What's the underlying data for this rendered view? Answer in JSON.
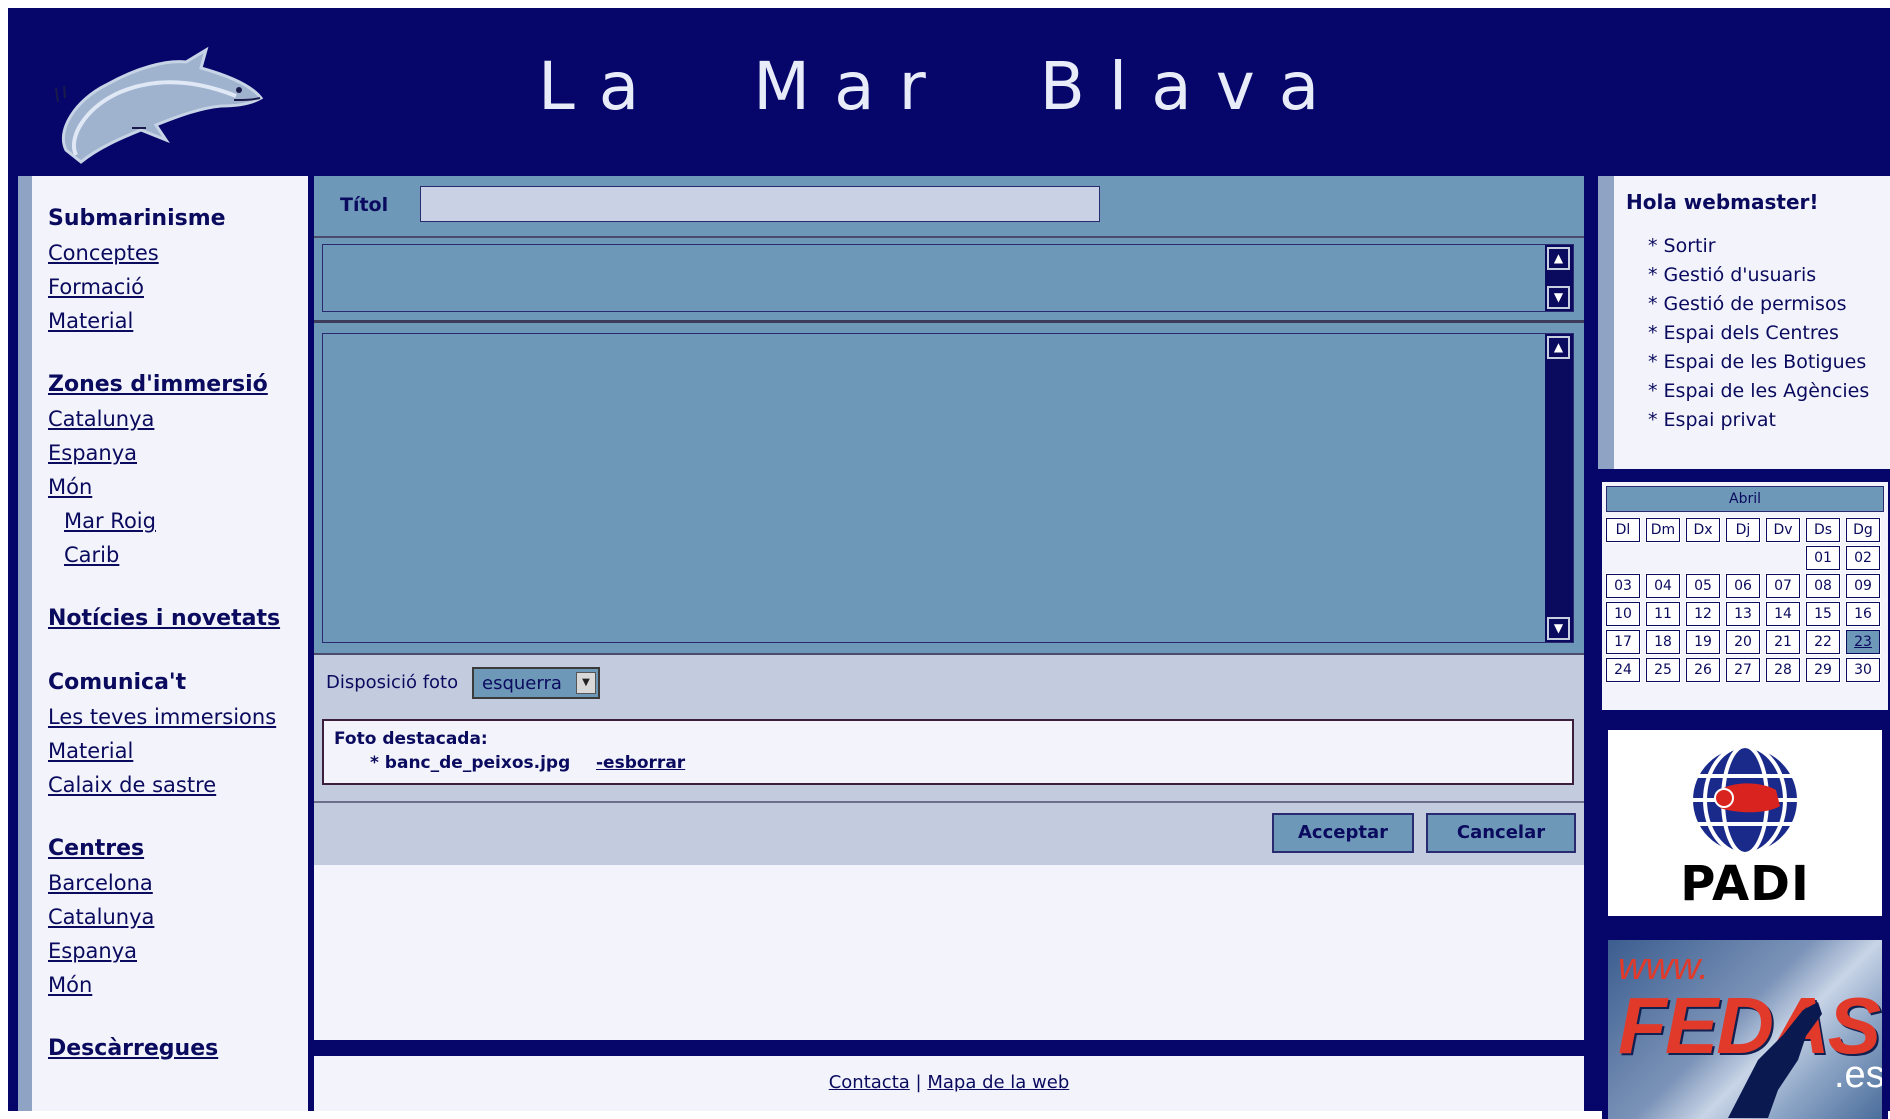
{
  "header": {
    "title": "La  Mar  Blava"
  },
  "sidebar": {
    "sections": [
      {
        "heading": "Submarinisme",
        "heading_link": false,
        "links": [
          "Conceptes",
          "Formació",
          "Material"
        ]
      },
      {
        "heading": "Zones d'immersió",
        "heading_link": true,
        "links": [
          "Catalunya",
          "Espanya",
          "Món"
        ],
        "sublinks": [
          "Mar Roig",
          "Carib"
        ]
      },
      {
        "heading": "Notícies i novetats",
        "heading_link": true,
        "links": []
      },
      {
        "heading": "Comunica't",
        "heading_link": false,
        "links": [
          "Les teves immersions",
          "Material",
          "Calaix de sastre"
        ]
      },
      {
        "heading": "Centres",
        "heading_link": true,
        "links": [
          "Barcelona",
          "Catalunya",
          "Espanya",
          "Món"
        ]
      },
      {
        "heading": "Descàrregues",
        "heading_link": true,
        "links": []
      }
    ]
  },
  "form": {
    "title_label": "Títol",
    "title_value": "",
    "layout_label": "Disposició foto",
    "layout_value": "esquerra",
    "photo_heading": "Foto destacada:",
    "photo_file": "* banc_de_peixos.jpg",
    "photo_delete": "-esborrar",
    "accept_label": "Acceptar",
    "cancel_label": "Cancelar"
  },
  "footer": {
    "contact": "Contacta",
    "separator": "|",
    "sitemap": "Mapa de la web"
  },
  "user": {
    "greeting": "Hola webmaster!",
    "menu": [
      "* Sortir",
      "* Gestió d'usuaris",
      "* Gestió de permisos",
      "* Espai dels Centres",
      "* Espai de les Botigues",
      "* Espai de les Agències",
      "* Espai privat"
    ]
  },
  "calendar": {
    "month": "Abril",
    "weekdays": [
      "Dl",
      "Dm",
      "Dx",
      "Dj",
      "Dv",
      "Ds",
      "Dg"
    ],
    "weeks": [
      [
        "",
        "",
        "",
        "",
        "",
        "01",
        "02"
      ],
      [
        "03",
        "04",
        "05",
        "06",
        "07",
        "08",
        "09"
      ],
      [
        "10",
        "11",
        "12",
        "13",
        "14",
        "15",
        "16"
      ],
      [
        "17",
        "18",
        "19",
        "20",
        "21",
        "22",
        "23"
      ],
      [
        "24",
        "25",
        "26",
        "27",
        "28",
        "29",
        "30"
      ]
    ],
    "today": "23"
  },
  "banners": {
    "padi": "PADI",
    "fedas_www": "www.",
    "fedas_name": "FEDAS",
    "fedas_tld": ".es"
  },
  "colors": {
    "navy": "#06066a",
    "steel": "#6e98b8",
    "panel": "#f3f4fb",
    "light": "#c3ccdf"
  }
}
